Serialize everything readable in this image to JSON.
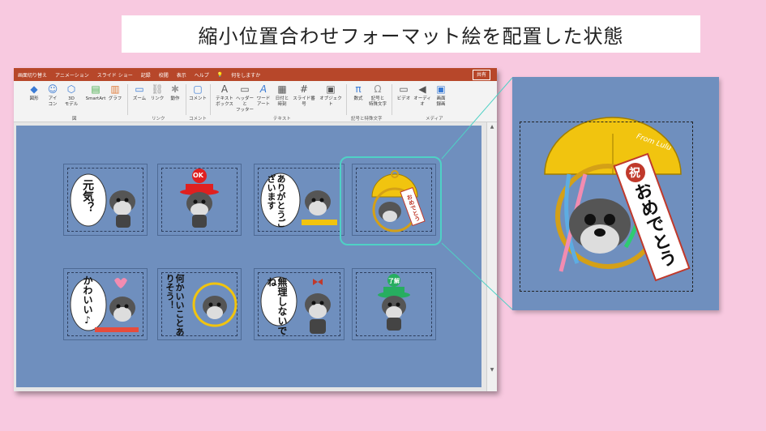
{
  "heading": "縮小位置合わせフォーマット絵を配置した状態",
  "menubar": {
    "items": [
      "画面切り替え",
      "アニメーション",
      "スライド ショー",
      "記録",
      "校閲",
      "表示",
      "ヘルプ"
    ],
    "search_label": "何をしますか",
    "share_label": "共有"
  },
  "ribbon": {
    "buttons": [
      {
        "label": "図形"
      },
      {
        "label": "アイ\nコン"
      },
      {
        "label": "3D\nモデル"
      },
      {
        "label": "SmartArt"
      },
      {
        "label": "グラフ"
      },
      {
        "label": "ズーム"
      },
      {
        "label": "リンク"
      },
      {
        "label": "動作"
      },
      {
        "label": "コメント"
      },
      {
        "label": "テキスト\nボックス"
      },
      {
        "label": "ヘッダーと\nフッター"
      },
      {
        "label": "ワード\nアート"
      },
      {
        "label": "日付と\n時刻"
      },
      {
        "label": "スライド番号"
      },
      {
        "label": "オブジェクト"
      },
      {
        "label": "数式"
      },
      {
        "label": "記号と\n特殊文字"
      },
      {
        "label": "ビデオ"
      },
      {
        "label": "オーディオ"
      },
      {
        "label": "画面\n録画"
      }
    ],
    "groups": [
      "図",
      "リンク",
      "コメント",
      "テキスト",
      "記号と特殊文字",
      "メディア"
    ]
  },
  "stickers": [
    {
      "text": "元気？",
      "badge": ""
    },
    {
      "text": "",
      "badge": "OK"
    },
    {
      "text": "ありがとうございます",
      "badge": ""
    },
    {
      "text": "",
      "badge": "おめでとう"
    },
    {
      "text": "かわいい♪",
      "badge": ""
    },
    {
      "text": "何かいいことありそう！",
      "badge": ""
    },
    {
      "text": "無理しないでね",
      "badge": ""
    },
    {
      "text": "",
      "badge": "了解"
    }
  ],
  "zoom": {
    "badge": "祝",
    "banner_text": "おめでとう",
    "brand": "From Lulu"
  },
  "colors": {
    "accent": "#b7472a",
    "slide": "#6f8fbe",
    "highlight": "#4fd1c5",
    "page_bg": "#f8c9e0"
  }
}
